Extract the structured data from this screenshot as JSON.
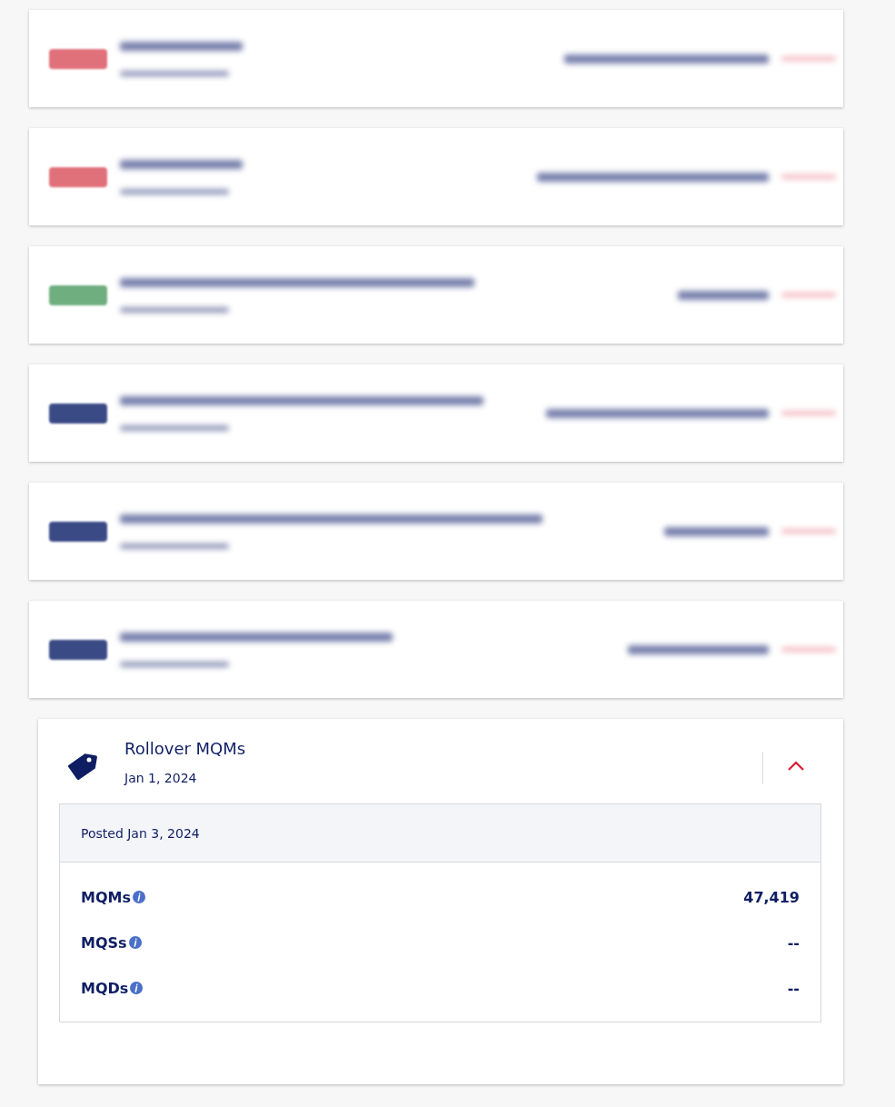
{
  "blurred_rows": [
    {
      "color": "#e0707a"
    },
    {
      "color": "#e0707a"
    },
    {
      "color": "#6fae7f"
    },
    {
      "color": "#3a4a85"
    },
    {
      "color": "#3a4a85"
    },
    {
      "color": "#3a4a85"
    }
  ],
  "activity": {
    "title": "Rollover MQMs",
    "date": "Jan 1, 2024",
    "expanded": true,
    "posted": "Posted Jan 3, 2024",
    "rows": [
      {
        "label": "MQMs",
        "value": "47,419"
      },
      {
        "label": "MQSs",
        "value": "--"
      },
      {
        "label": "MQDs",
        "value": "--"
      }
    ]
  }
}
